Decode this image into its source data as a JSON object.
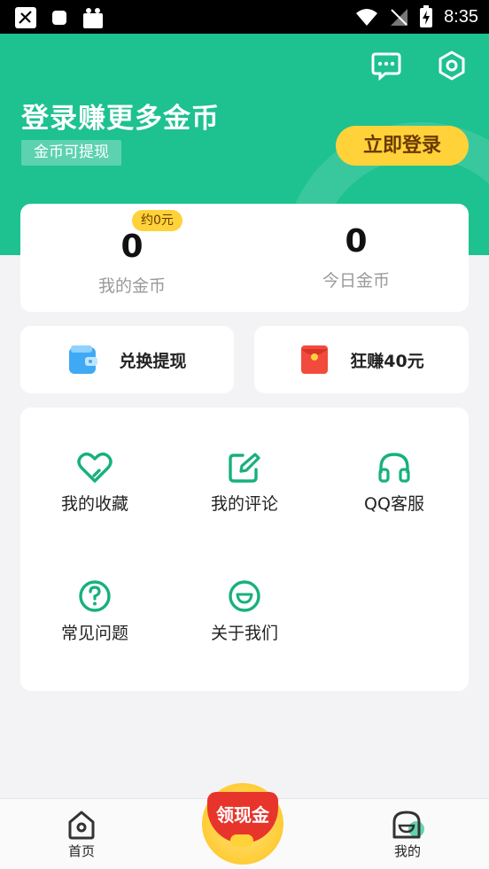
{
  "status_bar": {
    "time": "8:35"
  },
  "header": {
    "title": "登录赚更多金币",
    "subtitle": "金币可提现",
    "login_button": "立即登录"
  },
  "coins": {
    "approx_badge": "约0元",
    "my_coins_value": "0",
    "my_coins_label": "我的金币",
    "today_coins_value": "0",
    "today_coins_label": "今日金币"
  },
  "actions": {
    "withdraw_label": "兑换提现",
    "earn_label": "狂赚40元"
  },
  "grid": {
    "items": [
      {
        "label": "我的收藏",
        "icon": "heart-icon"
      },
      {
        "label": "我的评论",
        "icon": "edit-icon"
      },
      {
        "label": "QQ客服",
        "icon": "headset-icon"
      },
      {
        "label": "常见问题",
        "icon": "question-icon"
      },
      {
        "label": "关于我们",
        "icon": "smile-icon"
      }
    ]
  },
  "bottom_nav": {
    "home_label": "首页",
    "center_label": "领现金",
    "mine_label": "我的"
  },
  "colors": {
    "brand_green": "#1ec190",
    "icon_green": "#17b07f",
    "accent_yellow": "#ffd23a",
    "red": "#e8352b"
  }
}
